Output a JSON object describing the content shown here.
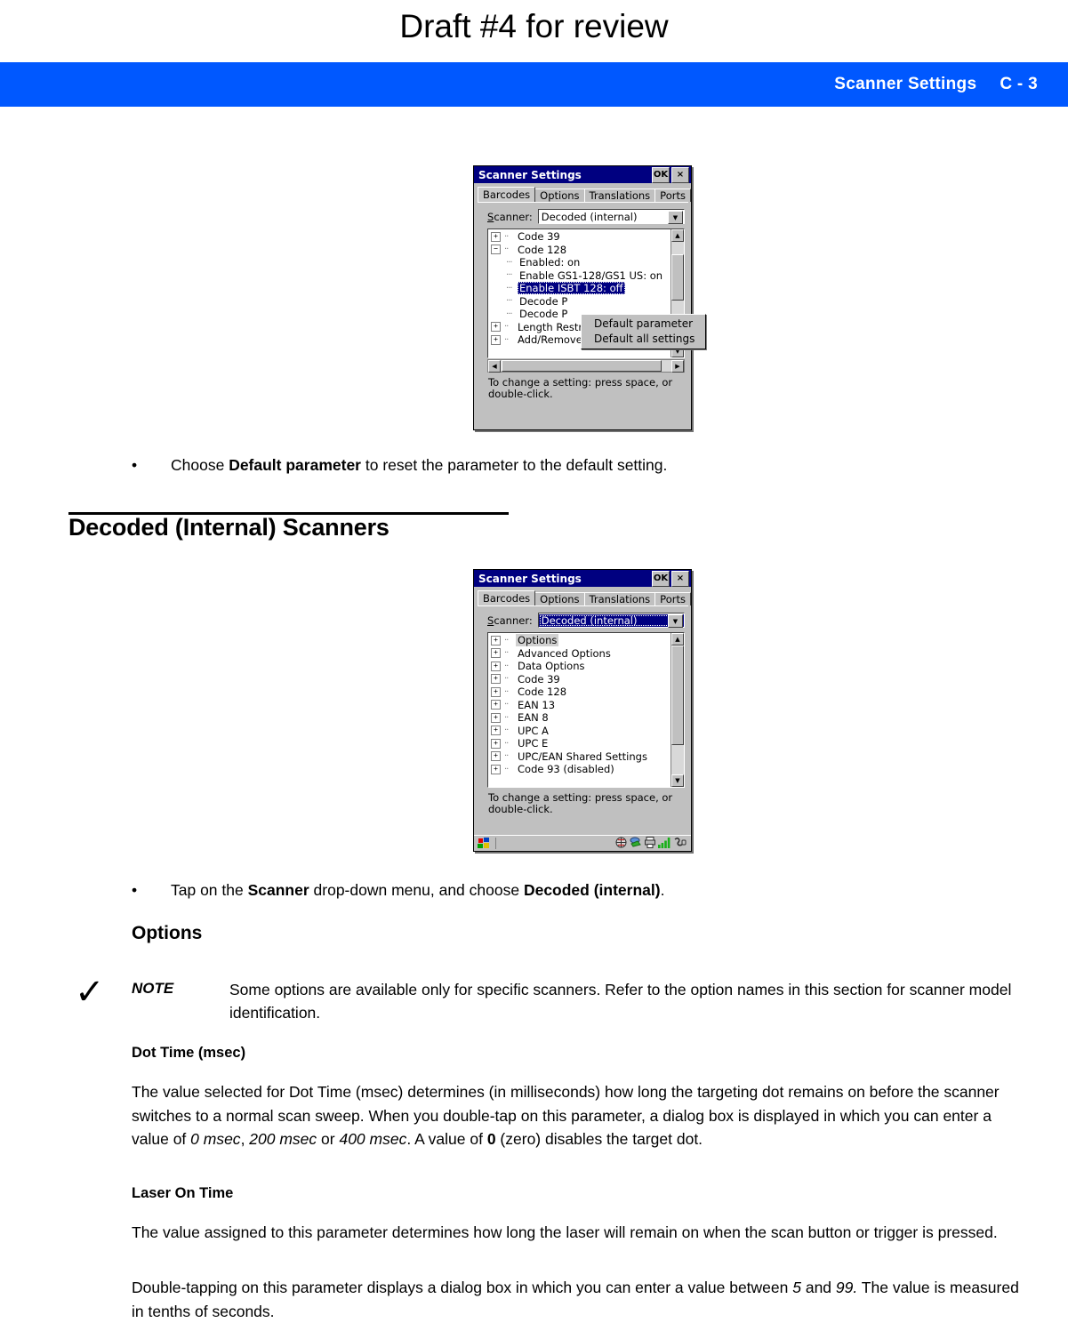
{
  "draft_note": "Draft #4 for review",
  "running_header": {
    "title": "Scanner Settings",
    "page_number": "C - 3",
    "background_color": "#0058ff",
    "text_color": "#ffffff"
  },
  "figure_1": {
    "window_title": "Scanner Settings",
    "title_buttons": [
      {
        "name": "ok-button",
        "label": "OK"
      },
      {
        "name": "close-button",
        "label": "×"
      }
    ],
    "tabs": [
      {
        "label": "Barcodes",
        "active": true
      },
      {
        "label": "Options",
        "active": false
      },
      {
        "label": "Translations",
        "active": false
      },
      {
        "label": "Ports",
        "active": false
      }
    ],
    "scanner_field": {
      "label": "Scanner:",
      "value": "Decoded (internal)",
      "selected": false
    },
    "tree_items": [
      {
        "label": "Code 39",
        "type": "collapsed",
        "indent": 0
      },
      {
        "label": "Code 128",
        "type": "expanded",
        "indent": 0
      },
      {
        "label": "Enabled: on",
        "type": "leaf",
        "indent": 1
      },
      {
        "label": "Enable GS1-128/GS1 US: on",
        "type": "leaf",
        "indent": 1
      },
      {
        "label": "Enable ISBT 128: off",
        "type": "leaf",
        "indent": 1,
        "selected": true
      },
      {
        "label": "Decode P",
        "type": "leaf",
        "indent": 1
      },
      {
        "label": "Decode P",
        "type": "leaf",
        "indent": 1
      },
      {
        "label": "Length Restriction",
        "type": "collapsed",
        "indent": 0
      },
      {
        "label": "Add/Remove Data",
        "type": "collapsed",
        "indent": 0
      }
    ],
    "context_menu": [
      "Default parameter",
      "Default all settings"
    ],
    "hint_text": "To change a setting: press space, or double-click."
  },
  "figure_2": {
    "window_title": "Scanner Settings",
    "title_buttons": [
      {
        "name": "ok-button",
        "label": "OK"
      },
      {
        "name": "close-button",
        "label": "×"
      }
    ],
    "tabs": [
      {
        "label": "Barcodes",
        "active": true
      },
      {
        "label": "Options",
        "active": false
      },
      {
        "label": "Translations",
        "active": false
      },
      {
        "label": "Ports",
        "active": false
      }
    ],
    "scanner_field": {
      "label": "Scanner:",
      "value": "Decoded (internal)",
      "selected": true
    },
    "tree_items": [
      {
        "label": "Options",
        "type": "collapsed",
        "highlighted": true
      },
      {
        "label": "Advanced Options",
        "type": "collapsed"
      },
      {
        "label": "Data Options",
        "type": "collapsed"
      },
      {
        "label": "Code 39",
        "type": "collapsed"
      },
      {
        "label": "Code 128",
        "type": "collapsed"
      },
      {
        "label": "EAN 13",
        "type": "collapsed"
      },
      {
        "label": "EAN 8",
        "type": "collapsed"
      },
      {
        "label": "UPC A",
        "type": "collapsed"
      },
      {
        "label": "UPC E",
        "type": "collapsed"
      },
      {
        "label": "UPC/EAN Shared Settings",
        "type": "collapsed"
      },
      {
        "label": "Code 93 (disabled)",
        "type": "collapsed"
      }
    ],
    "hint_text": "To change a setting: press space, or double-click.",
    "taskbar": {
      "start_icon": "windows-start-icon",
      "tray_icons": [
        "network-globe-icon",
        "activesync-icon",
        "printer-icon",
        "signal-strength-icon",
        "power-plug-icon"
      ]
    }
  },
  "body": {
    "bullet_1": {
      "marker": "•",
      "before": "Choose ",
      "bold": "Default parameter",
      "after": " to reset the parameter to the default setting."
    },
    "section_heading": "Decoded (Internal) Scanners",
    "bullet_2": {
      "marker": "•",
      "before": "Tap on the ",
      "bold_1": "Scanner",
      "middle": " drop-down menu, and choose ",
      "bold_2": "Decoded (internal)",
      "after": "."
    },
    "subsection_heading": "Options",
    "note": {
      "check_glyph": "✓",
      "label": "NOTE",
      "text": "Some options are available only for specific scanners. Refer to the option names in this section for scanner model identification."
    },
    "dot_time": {
      "heading": "Dot Time (msec)",
      "p1_a": "The value selected for Dot Time (msec) determines (in milliseconds) how long the targeting dot remains on before the scanner switches to a normal scan sweep. When you double-tap on this parameter, a dialog box is displayed in which you can enter a value of ",
      "p1_i1": "0 msec",
      "p1_b": ", ",
      "p1_i2": "200 msec",
      "p1_c": " or ",
      "p1_i3": "400 msec",
      "p1_d": ". A value of ",
      "p1_bold": "0",
      "p1_e": " (zero) disables the target dot."
    },
    "laser_on_time": {
      "heading": "Laser On Time",
      "p1": "The value assigned to this parameter determines how long the laser will remain on when the scan button or trigger is pressed.",
      "p2_a": "Double-tapping on this parameter displays a dialog box in which you can enter a value between ",
      "p2_i1": "5",
      "p2_b": " and ",
      "p2_i2": "99.",
      "p2_c": " The value is measured in tenths of seconds."
    }
  }
}
